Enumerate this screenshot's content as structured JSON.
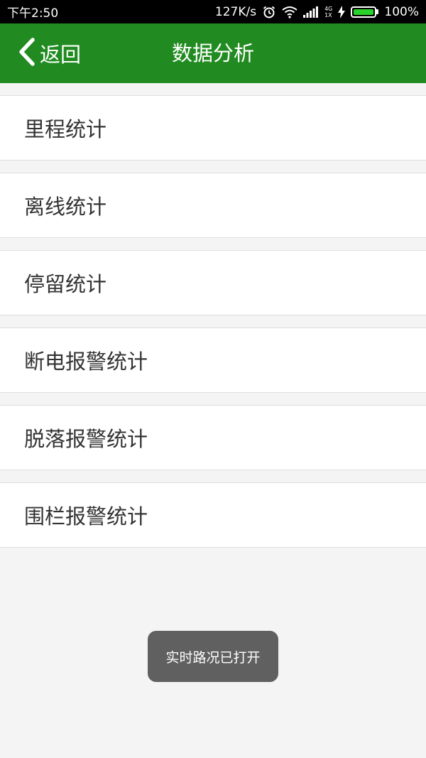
{
  "status_bar": {
    "time": "下午2:50",
    "net_speed": "127K/s",
    "net_type_top": "4G",
    "net_type_bottom": "1X",
    "battery": "100%",
    "battery_level": 1.0,
    "battery_color": "#2bd12b",
    "icons": [
      "alarm-icon",
      "wifi-icon",
      "signal-icon",
      "charging-icon",
      "battery-icon"
    ]
  },
  "nav": {
    "back_label": "返回",
    "title": "数据分析",
    "background": "#218b21"
  },
  "menu": {
    "items": [
      {
        "label": "里程统计"
      },
      {
        "label": "离线统计"
      },
      {
        "label": "停留统计"
      },
      {
        "label": "断电报警统计"
      },
      {
        "label": "脱落报警统计"
      },
      {
        "label": "围栏报警统计"
      }
    ]
  },
  "toast": {
    "message": "实时路况已打开"
  }
}
